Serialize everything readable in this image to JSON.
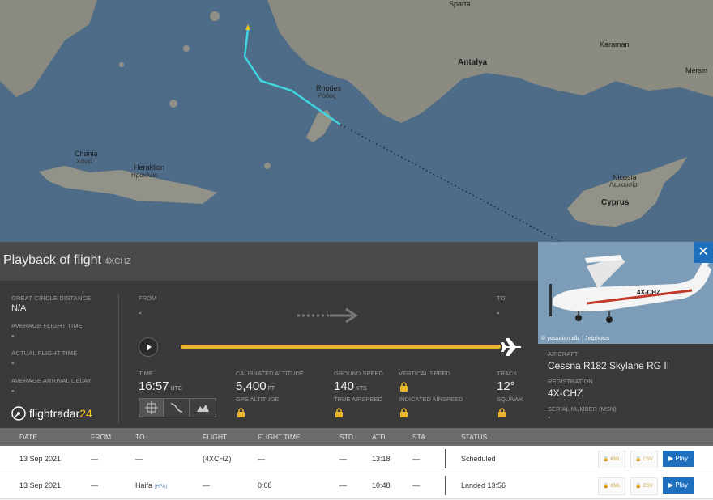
{
  "map": {
    "labels": {
      "antalya": "Antalya",
      "karaman": "Karaman",
      "mersin": "Mersin",
      "rhodes": "Rhodes",
      "rhodes_gr": "Ρόδος",
      "chania": "Chania",
      "chania_gr": "Χανιά",
      "heraklion": "Heraklion",
      "heraklion_gr": "Ηράκλειο",
      "nicosia": "Nicosia",
      "nicosia_gr": "Λευκωσία",
      "cyprus": "Cyprus",
      "sparta": "Sparta"
    }
  },
  "panel": {
    "title": "Playback of flight",
    "callsign": "4XCHZ",
    "close_icon": "close-icon"
  },
  "stats": {
    "gcd_label": "GREAT CIRCLE DISTANCE",
    "gcd_value": "N/A",
    "avg_flight_label": "AVERAGE FLIGHT TIME",
    "avg_flight_value": "-",
    "actual_flight_label": "ACTUAL FLIGHT TIME",
    "actual_flight_value": "-",
    "avg_arrival_label": "AVERAGE ARRIVAL DELAY",
    "avg_arrival_value": "-"
  },
  "route": {
    "from_label": "FROM",
    "from_value": "-",
    "to_label": "TO",
    "to_value": "-",
    "progress": 1.0
  },
  "telemetry": {
    "time_label": "TIME",
    "time_value": "16:57",
    "time_unit": "UTC",
    "cal_alt_label": "CALIBRATED ALTITUDE",
    "cal_alt_value": "5,400",
    "cal_alt_unit": "FT",
    "gps_alt_label": "GPS ALTITUDE",
    "ground_speed_label": "GROUND SPEED",
    "ground_speed_value": "140",
    "ground_speed_unit": "KTS",
    "true_airspeed_label": "TRUE AIRSPEED",
    "vertical_speed_label": "VERTICAL SPEED",
    "indicated_airspeed_label": "INDICATED AIRSPEED",
    "track_label": "TRACK",
    "track_value": "12°",
    "squawk_label": "SQUAWK"
  },
  "aircraft": {
    "photo_credit": "© yossatan alb. | Jetphotos",
    "aircraft_label": "AIRCRAFT",
    "aircraft_value": "Cessna R182 Skylane RG II",
    "registration_label": "REGISTRATION",
    "registration_value": "4X-CHZ",
    "serial_label": "SERIAL NUMBER (MSN)",
    "serial_value": "-",
    "tail_marking": "4X-CHZ"
  },
  "logo": {
    "text": "flightradar",
    "num": "24"
  },
  "table": {
    "headers": [
      "DATE",
      "FROM",
      "TO",
      "FLIGHT",
      "FLIGHT TIME",
      "STD",
      "ATD",
      "STA",
      "STATUS"
    ],
    "rows": [
      {
        "date": "13 Sep 2021",
        "from": "—",
        "to": "—",
        "to_code": "",
        "flight": "(4XCHZ)",
        "flight_time": "—",
        "std": "—",
        "atd": "13:18",
        "sta": "—",
        "status": "Scheduled",
        "kml": "KML",
        "csv": "CSV",
        "play": "Play"
      },
      {
        "date": "13 Sep 2021",
        "from": "—",
        "to": "Haifa",
        "to_code": "(HFA)",
        "flight": "—",
        "flight_time": "0:08",
        "std": "—",
        "atd": "10:48",
        "sta": "—",
        "status": "Landed 13:56",
        "kml": "KML",
        "csv": "CSV",
        "play": "Play"
      }
    ]
  },
  "colors": {
    "track": "#3fd6e0",
    "progress": "#e8b52c",
    "accent": "#1f6fbf"
  }
}
